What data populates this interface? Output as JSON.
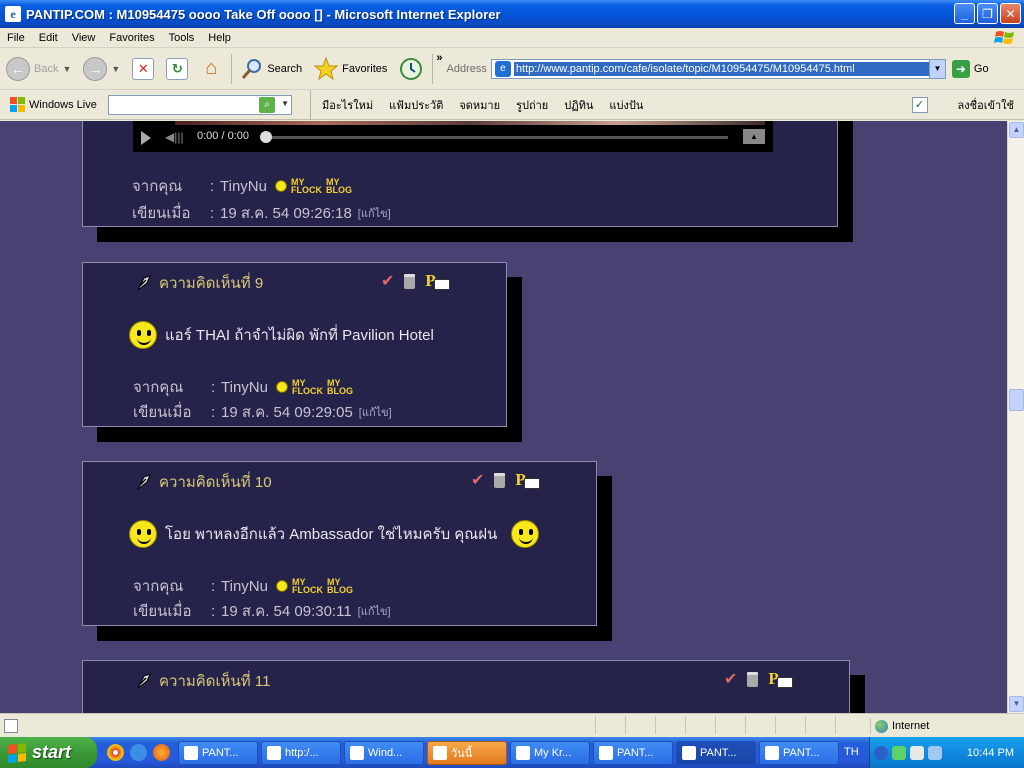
{
  "window": {
    "title": "PANTIP.COM : M10954475 oooo Take Off oooo [] - Microsoft Internet Explorer",
    "minimize": "_",
    "maximize": "❐",
    "close": "✕"
  },
  "menu": [
    "File",
    "Edit",
    "View",
    "Favorites",
    "Tools",
    "Help"
  ],
  "toolbar": {
    "back": "Back",
    "search": "Search",
    "favorites": "Favorites",
    "more": "»",
    "address_label": "Address",
    "address_value": "http://www.pantip.com/cafe/isolate/topic/M10954475/M10954475.html",
    "go": "Go"
  },
  "live": {
    "brand": "Windows Live",
    "search_placeholder": "",
    "links": [
      "มีอะไรใหม่",
      "แฟ้มประวัติ",
      "จดหมาย",
      "รูปถ่าย",
      "ปฏิทิน",
      "แบ่งปัน"
    ],
    "signin": "ลงชื่อเข้าใช้"
  },
  "player": {
    "time": "0:00 / 0:00"
  },
  "posts": [
    {
      "from_label": "จากคุณ",
      "author": "TinyNu",
      "date_label": "เขียนเมื่อ",
      "date": "19 ส.ค. 54 09:26:18",
      "edit": "[แก้ไข]"
    },
    {
      "heading": "ความคิดเห็นที่ 9",
      "body": "แอร์ THAI ถ้าจำไม่ผิด พักที่ Pavilion  Hotel",
      "from_label": "จากคุณ",
      "author": "TinyNu",
      "date_label": "เขียนเมื่อ",
      "date": "19 ส.ค. 54 09:29:05",
      "edit": "[แก้ไข]"
    },
    {
      "heading": "ความคิดเห็นที่ 10",
      "body": "โอย พาหลงอีกแล้ว Ambassador ใช่ไหมครับ คุณฝน",
      "from_label": "จากคุณ",
      "author": "TinyNu",
      "date_label": "เขียนเมื่อ",
      "date": "19 ส.ค. 54 09:30:11",
      "edit": "[แก้ไข]"
    },
    {
      "heading": "ความคิดเห็นที่ 11"
    }
  ],
  "badges": {
    "my": "MY",
    "flock": "FLOCK",
    "blog": "BLOG"
  },
  "status": {
    "zone": "Internet"
  },
  "taskbar": {
    "start": "start",
    "tasks": [
      "PANT...",
      "http:/...",
      "Wind...",
      "วันนี้",
      "My Kr...",
      "PANT...",
      "PANT...",
      "PANT..."
    ],
    "lang": "TH",
    "clock": "10:44 PM"
  },
  "colors": {
    "page_bg": "#474272",
    "post_bg": "#25234a",
    "heading": "#d8c878",
    "accent_yellow": "#f3d230"
  }
}
